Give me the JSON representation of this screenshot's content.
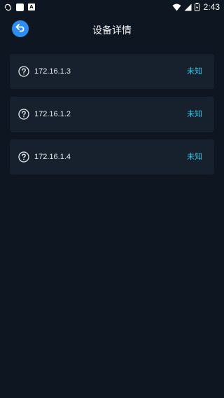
{
  "status_bar": {
    "time": "2:43",
    "left_icons": [
      "sync-icon",
      "notification-square-icon",
      "a-badge-icon"
    ],
    "right_icons": [
      "wifi-icon",
      "signal-icon",
      "battery-icon"
    ]
  },
  "header": {
    "title": "设备详情",
    "back_icon": "back-arrow-icon",
    "back_color": "#2f8cf0"
  },
  "devices": [
    {
      "ip": "172.16.1.3",
      "status": "未知",
      "icon": "question-circle-icon"
    },
    {
      "ip": "172.16.1.2",
      "status": "未知",
      "icon": "question-circle-icon"
    },
    {
      "ip": "172.16.1.4",
      "status": "未知",
      "icon": "question-circle-icon"
    }
  ],
  "colors": {
    "background": "#0d1621",
    "card": "#17212d",
    "status_text": "#33c6e6",
    "accent": "#2f8cf0"
  }
}
